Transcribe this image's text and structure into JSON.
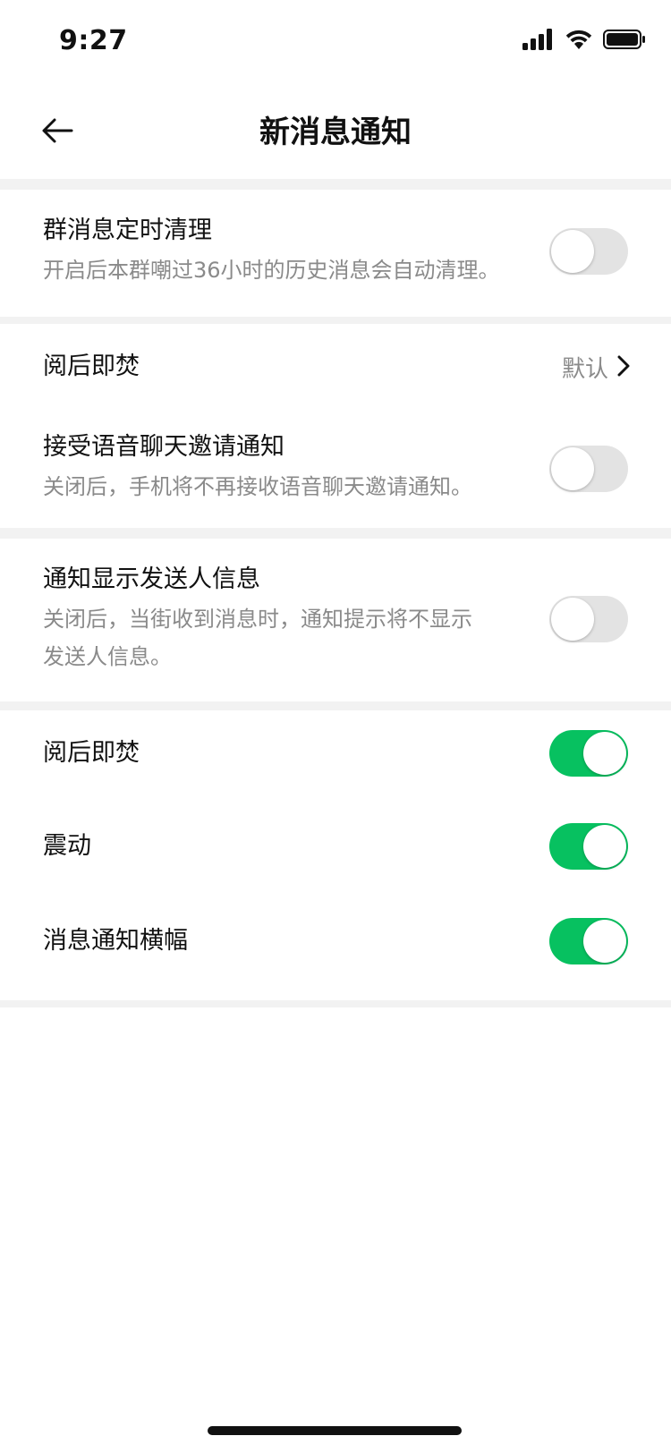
{
  "status_bar": {
    "time": "9:27",
    "icons": [
      "signal-icon",
      "wifi-icon",
      "battery-icon"
    ]
  },
  "nav": {
    "title": "新消息通知",
    "back_icon": "back-arrow-icon"
  },
  "colors": {
    "accent_green": "#07c160",
    "toggle_off": "#e3e3e3",
    "divider": "#f2f2f2",
    "subtext": "#8a8a8a"
  },
  "sections": [
    {
      "rows": [
        {
          "title": "群消息定时清理",
          "subtitle": "开启后本群嘲过36小时的历史消息会自动清理。",
          "control": "toggle",
          "on": false
        }
      ]
    },
    {
      "rows": [
        {
          "title": "阅后即焚",
          "control": "value",
          "value": "默认"
        },
        {
          "title": "接受语音聊天邀请通知",
          "subtitle": "关闭后，手机将不再接收语音聊天邀请通知。",
          "control": "toggle",
          "on": false
        }
      ]
    },
    {
      "rows": [
        {
          "title": "通知显示发送人信息",
          "subtitle_lines": [
            "关闭后，当街收到消息时，通知提示将不显示",
            "发送人信息。"
          ],
          "control": "toggle",
          "on": false
        }
      ]
    },
    {
      "rows": [
        {
          "title": "阅后即焚",
          "control": "toggle",
          "on": true
        },
        {
          "title": "震动",
          "control": "toggle",
          "on": true
        },
        {
          "title": "消息通知横幅",
          "control": "toggle",
          "on": true
        }
      ]
    }
  ]
}
